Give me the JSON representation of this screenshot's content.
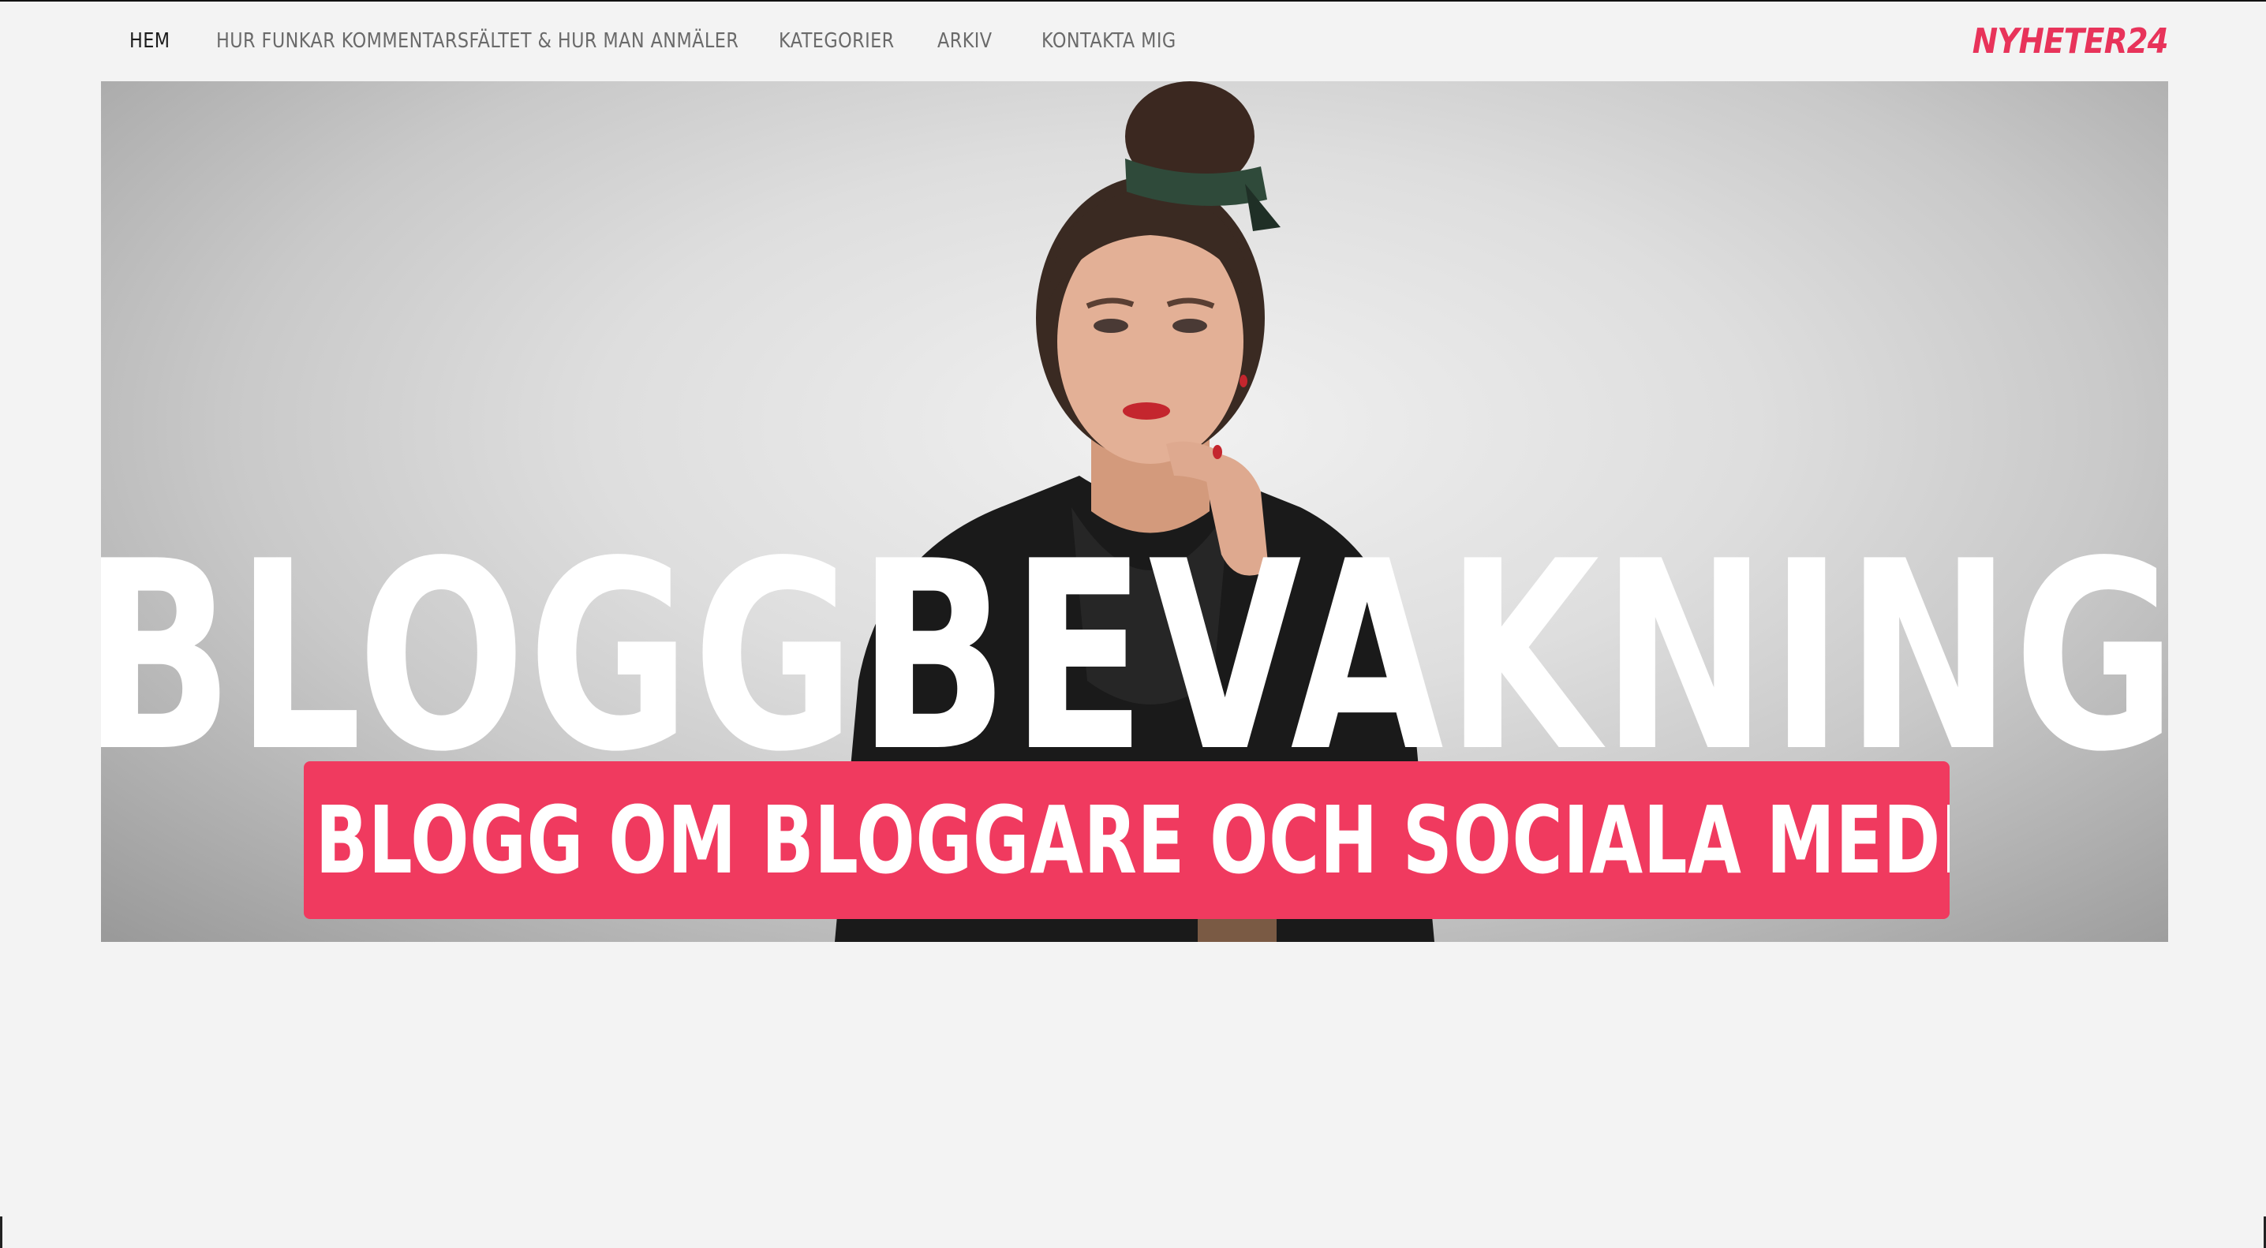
{
  "nav": {
    "items": [
      {
        "label": "HEM",
        "active": true
      },
      {
        "label": "HUR FUNKAR KOMMENTARSFÄLTET & HUR MAN ANMÄLER",
        "active": false
      },
      {
        "label": "KATEGORIER",
        "active": false
      },
      {
        "label": "ARKIV",
        "active": false
      },
      {
        "label": "KONTAKTA MIG",
        "active": false
      }
    ]
  },
  "logo": {
    "text": "NYHETER24",
    "color": "#e8335a"
  },
  "hero": {
    "title": "BLOGGBEVAKNING",
    "subtitle": "EN BLOGG OM BLOGGARE OCH SOCIALA MEDIER",
    "subtitle_background": "#f03a5f",
    "title_color": "#ffffff"
  },
  "colors": {
    "page_background": "#f3f3f3",
    "nav_text": "#6a6a6a",
    "nav_active_text": "#1b1b1b",
    "accent": "#e8335a"
  }
}
